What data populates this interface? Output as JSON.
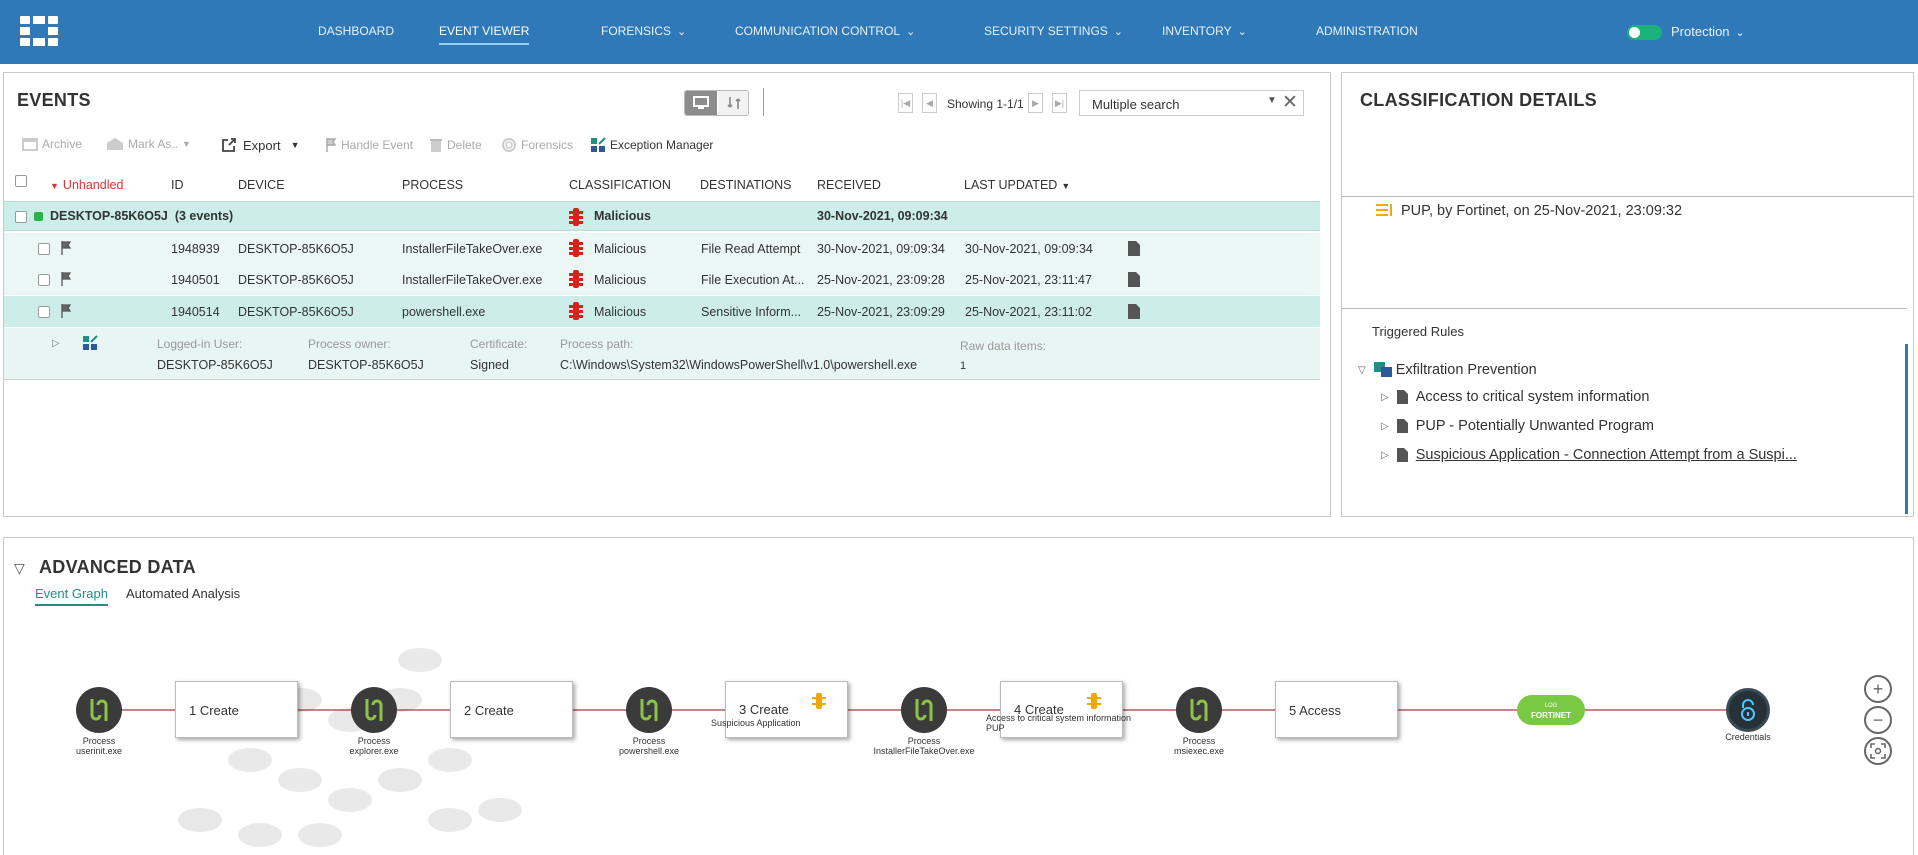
{
  "nav": {
    "items": [
      {
        "label": "DASHBOARD",
        "has_menu": false
      },
      {
        "label": "EVENT VIEWER",
        "has_menu": false,
        "active": true
      },
      {
        "label": "FORENSICS",
        "has_menu": true
      },
      {
        "label": "COMMUNICATION CONTROL",
        "has_menu": true
      },
      {
        "label": "SECURITY SETTINGS",
        "has_menu": true
      },
      {
        "label": "INVENTORY",
        "has_menu": true
      },
      {
        "label": "ADMINISTRATION",
        "has_menu": false
      }
    ],
    "protection_label": "Protection",
    "protection_on": true
  },
  "events": {
    "title": "EVENTS",
    "pager_text": "Showing 1-1/1",
    "search_value": "Multiple search",
    "toolbar": {
      "archive": "Archive",
      "mark_as": "Mark As..",
      "export": "Export",
      "handle_event": "Handle Event",
      "delete": "Delete",
      "forensics": "Forensics",
      "exception_manager": "Exception Manager"
    },
    "filter_label": "Unhandled",
    "columns": [
      "ID",
      "DEVICE",
      "PROCESS",
      "CLASSIFICATION",
      "DESTINATIONS",
      "RECEIVED",
      "LAST UPDATED"
    ],
    "group": {
      "device": "DESKTOP-85K6O5J",
      "count": "(3 events)",
      "classification": "Malicious",
      "received": "30-Nov-2021, 09:09:34"
    },
    "rows": [
      {
        "id": "1948939",
        "device": "DESKTOP-85K6O5J",
        "process": "InstallerFileTakeOver.exe",
        "classification": "Malicious",
        "destination": "File Read Attempt",
        "received": "30-Nov-2021, 09:09:34",
        "updated": "30-Nov-2021, 09:09:34"
      },
      {
        "id": "1940501",
        "device": "DESKTOP-85K6O5J",
        "process": "InstallerFileTakeOver.exe",
        "classification": "Malicious",
        "destination": "File Execution At...",
        "received": "25-Nov-2021, 23:09:28",
        "updated": "25-Nov-2021, 23:11:47"
      },
      {
        "id": "1940514",
        "device": "DESKTOP-85K6O5J",
        "process": "powershell.exe",
        "classification": "Malicious",
        "destination": "Sensitive Inform...",
        "received": "25-Nov-2021, 23:09:29",
        "updated": "25-Nov-2021, 23:11:02"
      }
    ],
    "details": {
      "logged_in_user_label": "Logged-in User:",
      "logged_in_user": "DESKTOP-85K6O5J",
      "process_owner_label": "Process owner:",
      "process_owner": "DESKTOP-85K6O5J",
      "certificate_label": "Certificate:",
      "certificate": "Signed",
      "process_path_label": "Process path:",
      "process_path": "C:\\Windows\\System32\\WindowsPowerShell\\v1.0\\powershell.exe",
      "raw_data_label": "Raw data items:",
      "raw_data": "1"
    }
  },
  "classification": {
    "title": "CLASSIFICATION DETAILS",
    "entry": "PUP, by Fortinet, on 25-Nov-2021, 23:09:32",
    "triggered_label": "Triggered Rules",
    "policy": "Exfiltration Prevention",
    "rules": [
      "Access to critical system information",
      "PUP - Potentially Unwanted Program",
      "Suspicious Application - Connection Attempt from a Suspi..."
    ]
  },
  "advanced": {
    "title": "ADVANCED DATA",
    "tabs": [
      "Event Graph",
      "Automated Analysis"
    ],
    "graph": {
      "processes": [
        {
          "line1": "Process",
          "line2": "userinit.exe"
        },
        {
          "line1": "Process",
          "line2": "explorer.exe"
        },
        {
          "line1": "Process",
          "line2": "powershell.exe"
        },
        {
          "line1": "Process",
          "line2": "InstallerFileTakeOver.exe"
        },
        {
          "line1": "Process",
          "line2": "msiexec.exe"
        }
      ],
      "actions": [
        {
          "label": "1 Create",
          "sub": ""
        },
        {
          "label": "2 Create",
          "sub": ""
        },
        {
          "label": "3 Create",
          "sub": "Suspicious Application"
        },
        {
          "label": "4 Create",
          "sub": "Access to critical system information",
          "sub2": "PUP"
        },
        {
          "label": "5 Access",
          "sub": ""
        }
      ],
      "fortinet_badge": "FORTINET",
      "fortinet_small": "LOG",
      "target_label": "Credentials"
    }
  },
  "colors": {
    "topbar": "#2f79b9",
    "accent": "#19b27b",
    "malicious": "#d9221c",
    "row_highlight": "#cdeee8",
    "edge": "#a33a3a"
  }
}
